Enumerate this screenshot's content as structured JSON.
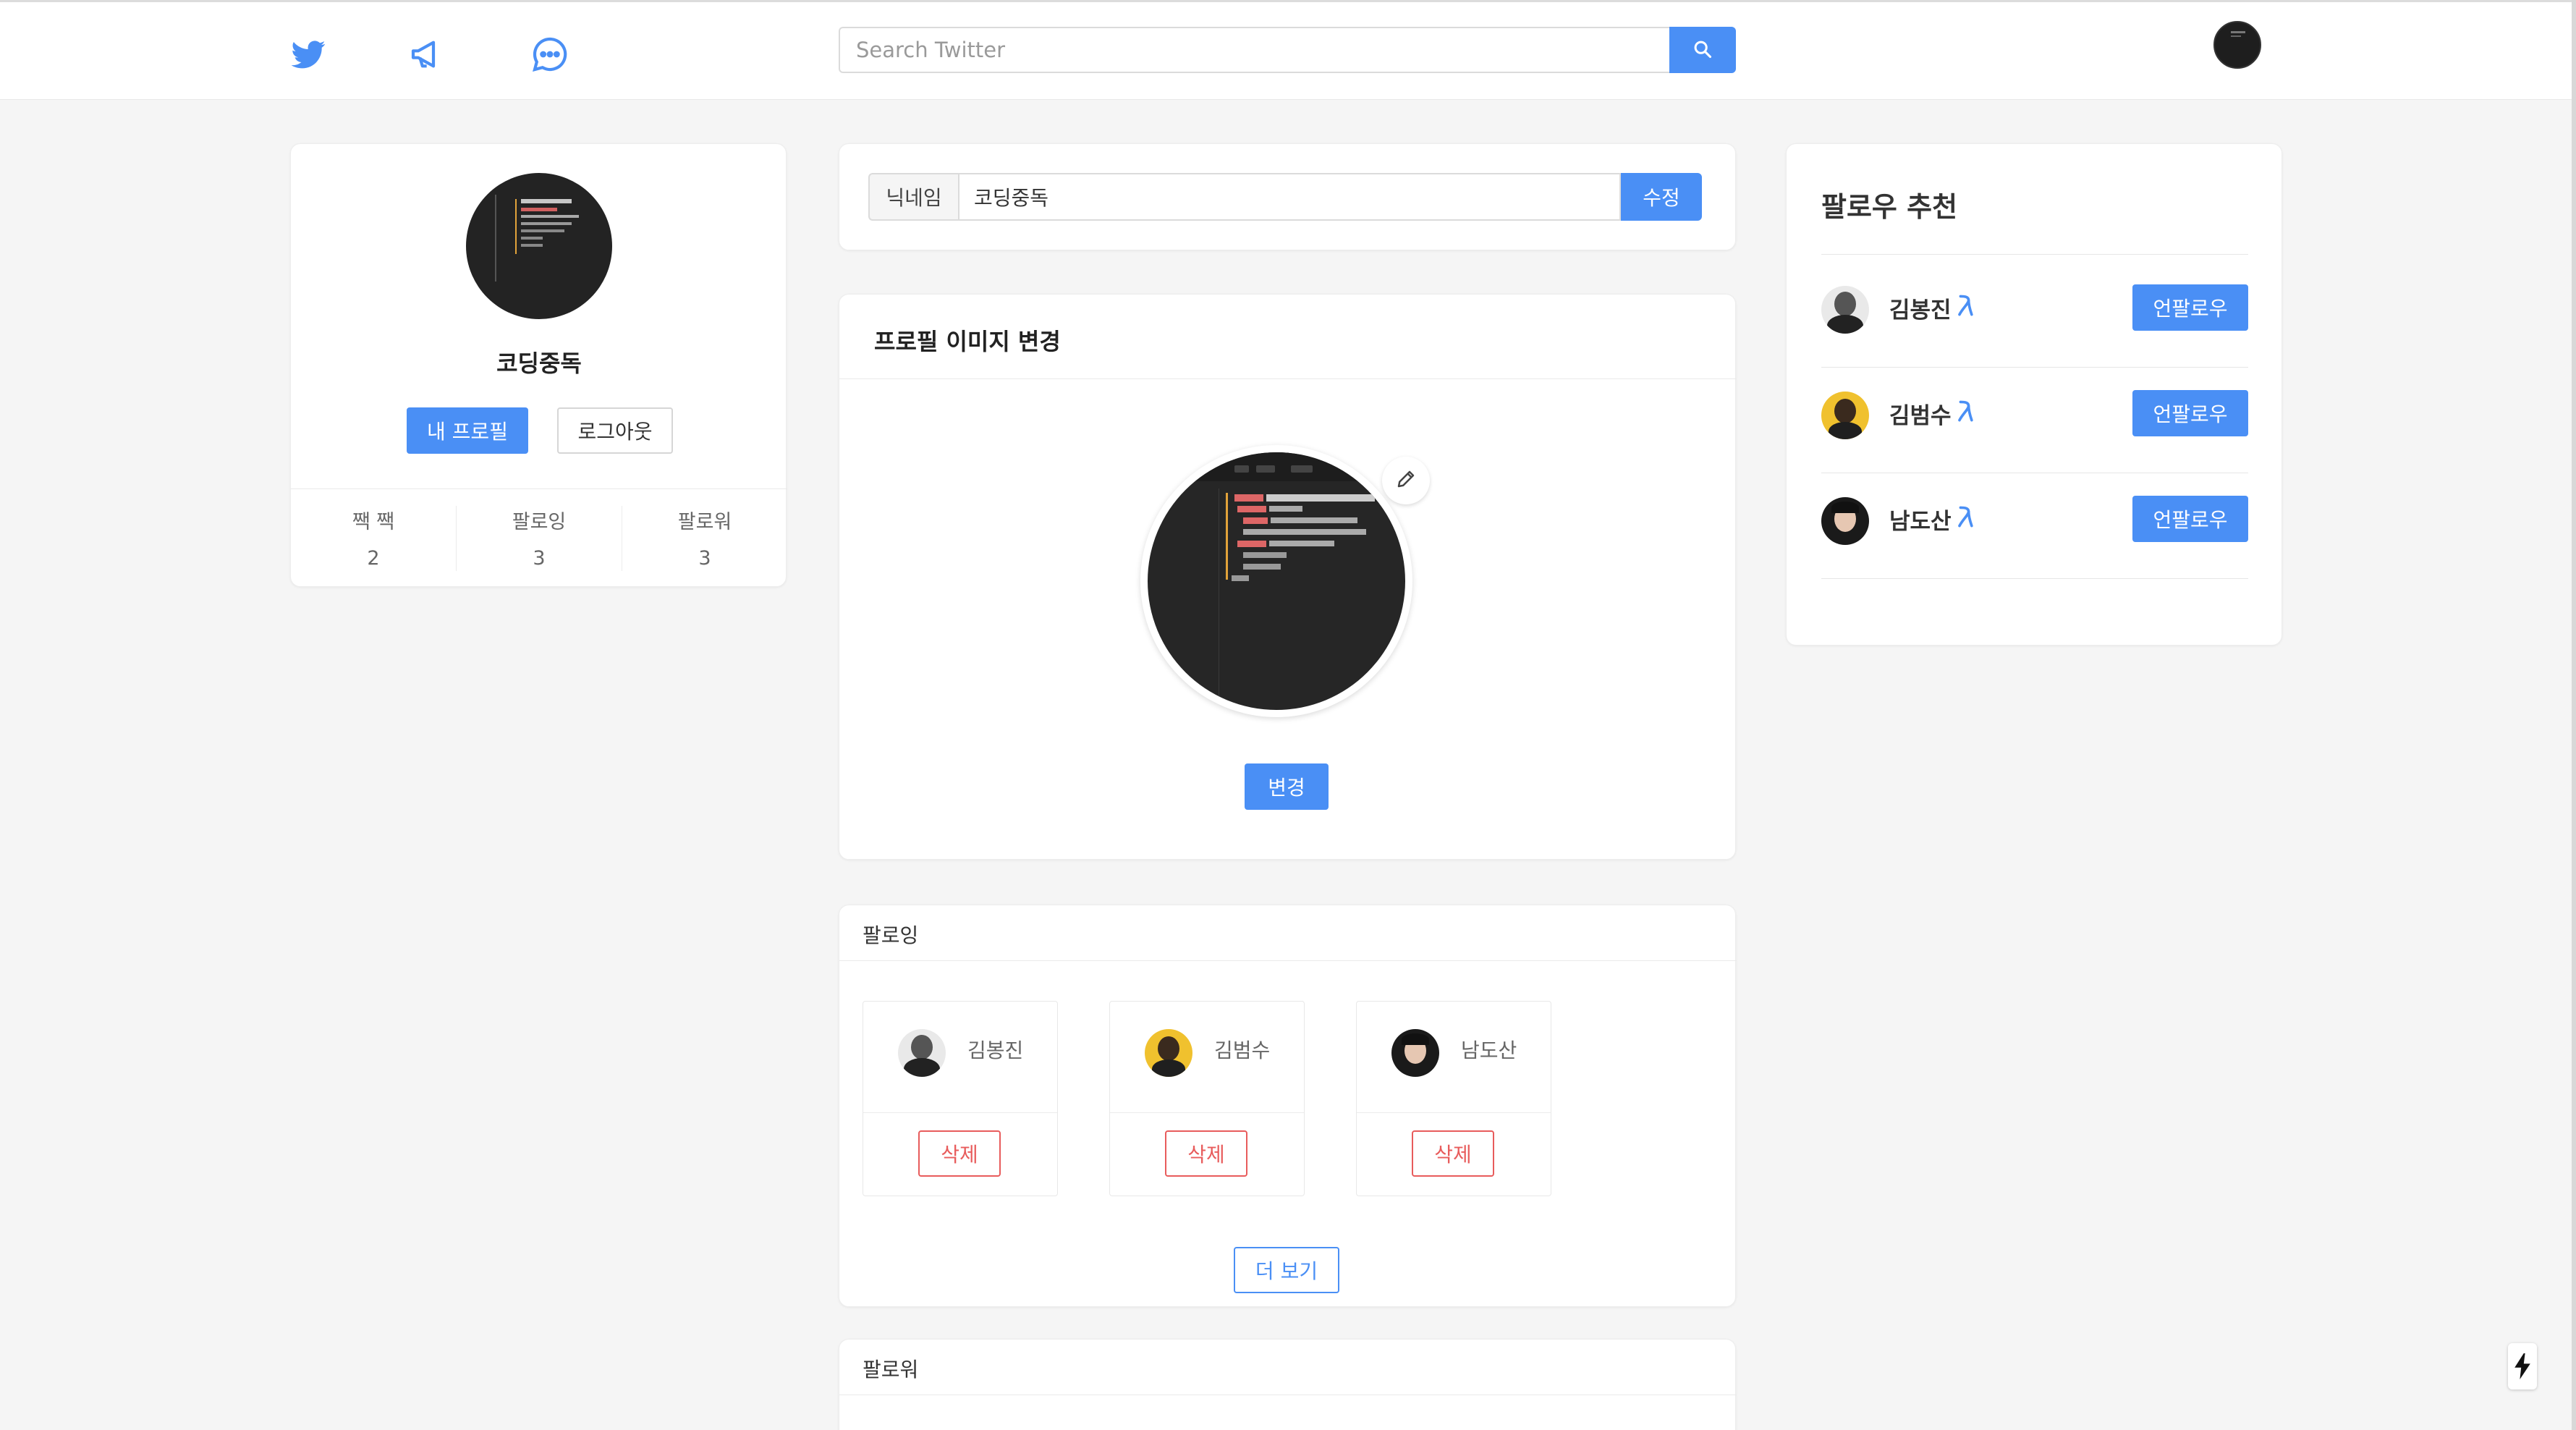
{
  "header": {
    "search_placeholder": "Search Twitter",
    "icons": [
      "twitter-bird-icon",
      "megaphone-icon",
      "chat-bubble-icon",
      "search-icon"
    ],
    "accent": "#4a8ff5"
  },
  "left_profile": {
    "name": "코딩중독",
    "my_profile_label": "내 프로필",
    "logout_label": "로그아웃",
    "stats": [
      {
        "label": "짹 짹",
        "value": "2"
      },
      {
        "label": "팔로잉",
        "value": "3"
      },
      {
        "label": "팔로워",
        "value": "3"
      }
    ]
  },
  "nickname": {
    "addon_label": "닉네임",
    "value": "코딩중독",
    "submit_label": "수정"
  },
  "profile_image": {
    "title": "프로필 이미지 변경",
    "change_label": "변경"
  },
  "following": {
    "title": "팔로잉",
    "users": [
      {
        "name": "김봉진",
        "delete_label": "삭제"
      },
      {
        "name": "김범수",
        "delete_label": "삭제"
      },
      {
        "name": "남도산",
        "delete_label": "삭제"
      }
    ],
    "more_label": "더 보기"
  },
  "followers": {
    "title": "팔로워"
  },
  "recommend": {
    "title": "팔로우 추천",
    "users": [
      {
        "name": "김봉진",
        "button_label": "언팔로우"
      },
      {
        "name": "김범수",
        "button_label": "언팔로우"
      },
      {
        "name": "남도산",
        "button_label": "언팔로우"
      }
    ]
  },
  "colors": {
    "primary": "#4a8ff5",
    "danger": "#e85c5c",
    "background": "#f5f5f5"
  }
}
